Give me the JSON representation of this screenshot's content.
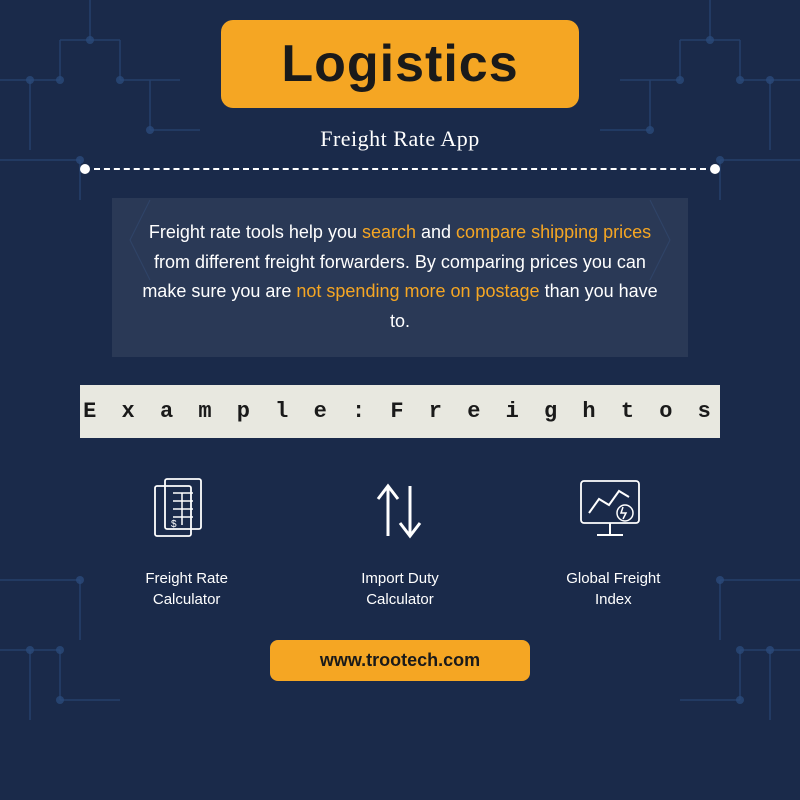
{
  "page": {
    "background_color": "#1a2a4a",
    "title": "Logistics",
    "subtitle": "Freight Rate App",
    "title_bg_color": "#f5a623",
    "accent_color": "#f5a623",
    "description": {
      "part1": "Freight rate tools help you ",
      "highlight1": "search",
      "part2": " and ",
      "highlight2": "compare shipping prices",
      "part3": " from different freight forwarders. By comparing prices you can make sure you are ",
      "highlight3": "not spending more on postage",
      "part4": " than you have to."
    },
    "example_label": "E x a m p l e : F r e i g h t o s",
    "icons": [
      {
        "id": "freight-rate-calculator",
        "label": "Freight Rate\nCalculator",
        "icon_type": "calculator"
      },
      {
        "id": "import-duty-calculator",
        "label": "Import Duty\nCalculator",
        "icon_type": "arrows"
      },
      {
        "id": "global-freight-index",
        "label": "Global Freight\nIndex",
        "icon_type": "chart"
      }
    ],
    "footer_url": "www.trootech.com"
  }
}
